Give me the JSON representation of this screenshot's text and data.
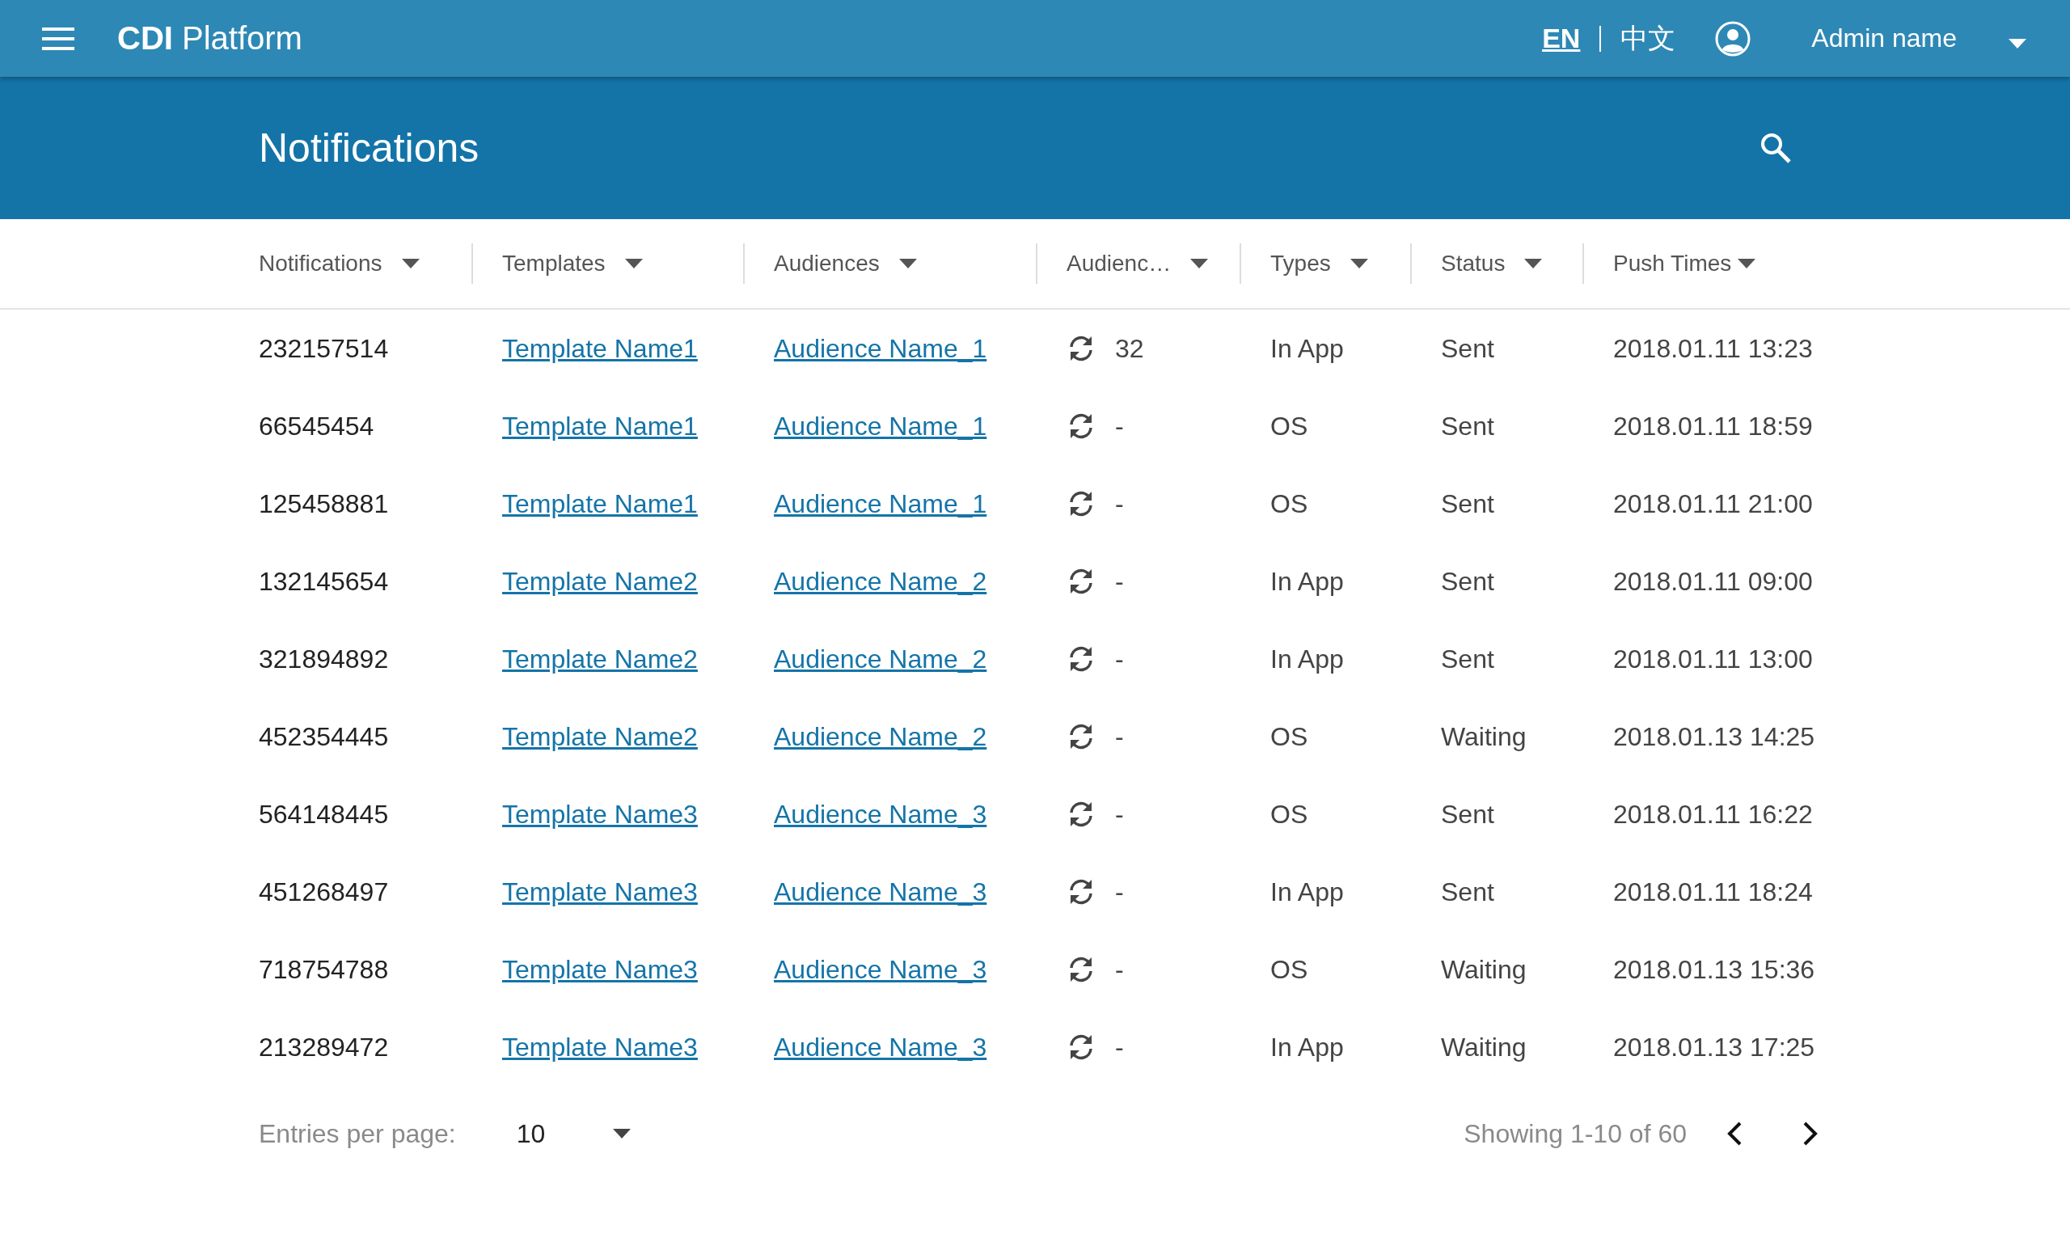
{
  "top_bar": {
    "brand": "**CDI** Platform",
    "languages": [
      {
        "label": "EN",
        "selected": true
      },
      {
        "label": "中文",
        "selected": false
      }
    ],
    "user": "Admin name"
  },
  "header": {
    "title": "Notifications"
  },
  "table": {
    "columns": [
      {
        "label": "Notifications"
      },
      {
        "label": "Templates"
      },
      {
        "label": "Audiences"
      },
      {
        "label": "Audienc…"
      },
      {
        "label": "Types"
      },
      {
        "label": "Status"
      },
      {
        "label": "Push Times"
      }
    ],
    "rows": [
      {
        "notification": "232157514",
        "template": "Template Name1",
        "audience": "Audience Name_1",
        "audience_count": "32",
        "type": "In App",
        "status": "Sent",
        "push_time": "2018.01.11 13:23"
      },
      {
        "notification": "66545454",
        "template": "Template Name1",
        "audience": "Audience Name_1",
        "audience_count": "-",
        "type": "OS",
        "status": "Sent",
        "push_time": "2018.01.11 18:59"
      },
      {
        "notification": "125458881",
        "template": "Template Name1",
        "audience": "Audience Name_1",
        "audience_count": "-",
        "type": "OS",
        "status": "Sent",
        "push_time": "2018.01.11 21:00"
      },
      {
        "notification": "132145654",
        "template": "Template Name2",
        "audience": "Audience Name_2",
        "audience_count": "-",
        "type": "In App",
        "status": "Sent",
        "push_time": "2018.01.11 09:00"
      },
      {
        "notification": "321894892",
        "template": "Template Name2",
        "audience": "Audience Name_2",
        "audience_count": "-",
        "type": "In App",
        "status": "Sent",
        "push_time": "2018.01.11 13:00"
      },
      {
        "notification": "452354445",
        "template": "Template Name2",
        "audience": "Audience Name_2",
        "audience_count": "-",
        "type": "OS",
        "status": "Waiting",
        "push_time": "2018.01.13 14:25"
      },
      {
        "notification": "564148445",
        "template": "Template Name3",
        "audience": "Audience Name_3",
        "audience_count": "-",
        "type": "OS",
        "status": "Sent",
        "push_time": "2018.01.11 16:22"
      },
      {
        "notification": "451268497",
        "template": "Template Name3",
        "audience": "Audience Name_3",
        "audience_count": "-",
        "type": "In App",
        "status": "Sent",
        "push_time": "2018.01.11 18:24"
      },
      {
        "notification": "718754788",
        "template": "Template Name3",
        "audience": "Audience Name_3",
        "audience_count": "-",
        "type": "OS",
        "status": "Waiting",
        "push_time": "2018.01.13 15:36"
      },
      {
        "notification": "213289472",
        "template": "Template Name3",
        "audience": "Audience Name_3",
        "audience_count": "-",
        "type": "In App",
        "status": "Waiting",
        "push_time": "2018.01.13 17:25"
      }
    ]
  },
  "pager": {
    "label": "Entries per page:",
    "per_page": "10",
    "showing": "Showing 1-10 of 60"
  }
}
